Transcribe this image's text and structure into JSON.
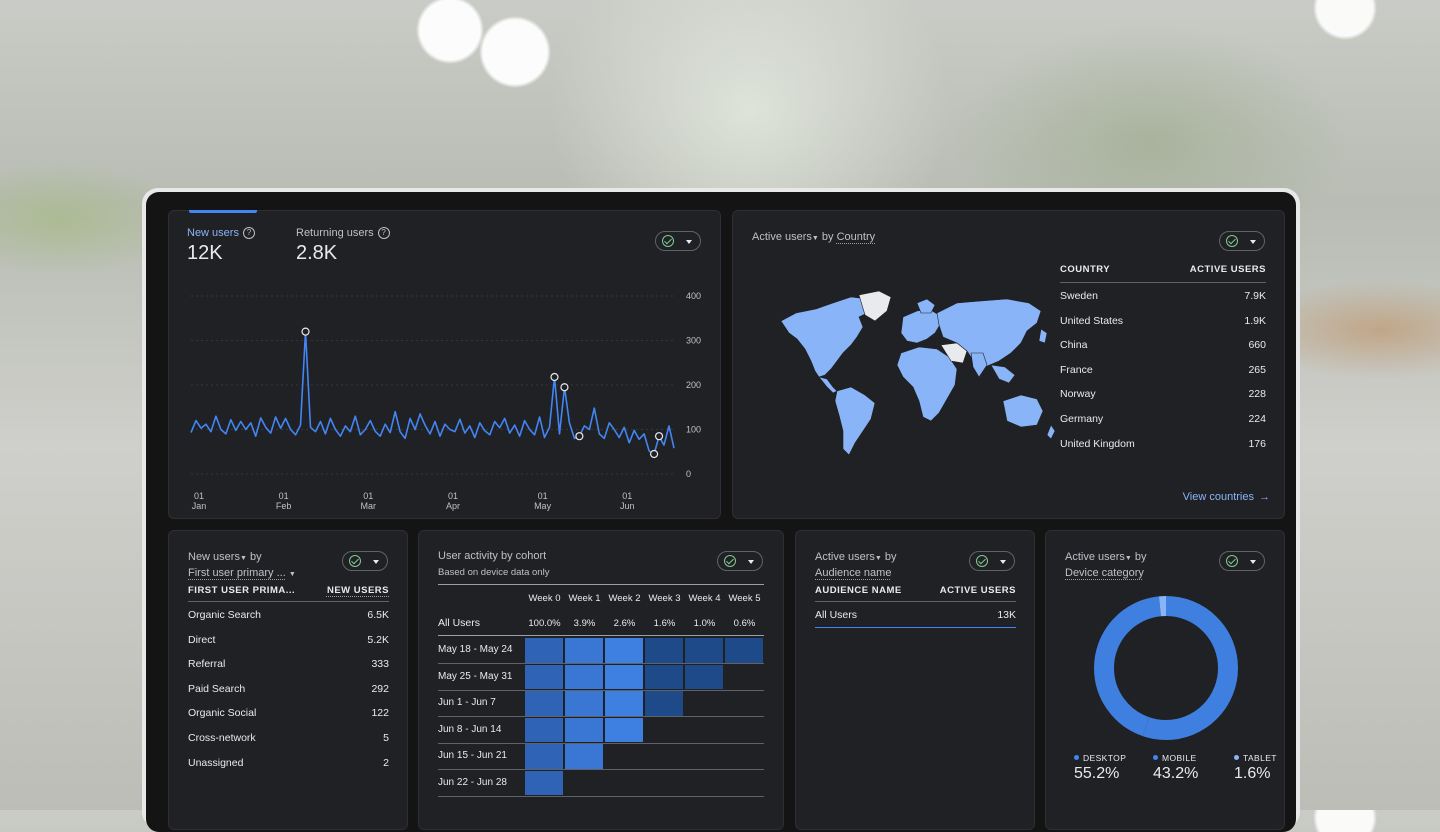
{
  "users_card": {
    "metric1_label": "New users",
    "metric1_value": "12K",
    "metric2_label": "Returning users",
    "metric2_value": "2.8K",
    "help_glyph": "?",
    "y_ticks": [
      "400",
      "300",
      "200",
      "100",
      "0"
    ],
    "x_ticks": [
      {
        "d": "01",
        "m": "Jan"
      },
      {
        "d": "01",
        "m": "Feb"
      },
      {
        "d": "01",
        "m": "Mar"
      },
      {
        "d": "01",
        "m": "Apr"
      },
      {
        "d": "01",
        "m": "May"
      },
      {
        "d": "01",
        "m": "Jun"
      }
    ],
    "line_color": "#4285f4",
    "series": [
      93,
      120,
      103,
      112,
      95,
      130,
      100,
      90,
      122,
      98,
      118,
      100,
      115,
      85,
      126,
      105,
      92,
      128,
      103,
      125,
      100,
      88,
      110,
      320,
      105,
      95,
      118,
      90,
      125,
      100,
      85,
      108,
      95,
      130,
      88,
      100,
      120,
      96,
      85,
      112,
      93,
      140,
      95,
      80,
      125,
      100,
      135,
      110,
      90,
      118,
      85,
      112,
      100,
      95,
      123,
      92,
      108,
      82,
      115,
      97,
      88,
      118,
      104,
      125,
      92,
      110,
      85,
      120,
      100,
      88,
      128,
      82,
      105,
      218,
      90,
      195,
      115,
      80,
      85,
      108,
      100,
      148,
      90,
      80,
      115,
      100,
      82,
      105,
      70,
      98,
      78,
      90,
      52,
      45,
      85,
      65,
      108,
      58
    ]
  },
  "country_card": {
    "title_metric": "Active users",
    "title_by": " by ",
    "title_dim": "Country",
    "col1": "COUNTRY",
    "col2": "ACTIVE USERS",
    "rows": [
      {
        "name": "Sweden",
        "value": "7.9K"
      },
      {
        "name": "United States",
        "value": "1.9K"
      },
      {
        "name": "China",
        "value": "660"
      },
      {
        "name": "France",
        "value": "265"
      },
      {
        "name": "Norway",
        "value": "228"
      },
      {
        "name": "Germany",
        "value": "224"
      },
      {
        "name": "United Kingdom",
        "value": "176"
      }
    ],
    "link": "View countries",
    "map_color": "#8ab4f8"
  },
  "source_card": {
    "title_metric": "New users",
    "title_by": " by",
    "title_dim": "First user primary ...",
    "col1": "FIRST USER PRIMA...",
    "col2": "NEW USERS",
    "rows": [
      {
        "name": "Organic Search",
        "value": "6.5K"
      },
      {
        "name": "Direct",
        "value": "5.2K"
      },
      {
        "name": "Referral",
        "value": "333"
      },
      {
        "name": "Paid Search",
        "value": "292"
      },
      {
        "name": "Organic Social",
        "value": "122"
      },
      {
        "name": "Cross-network",
        "value": "5"
      },
      {
        "name": "Unassigned",
        "value": "2"
      }
    ]
  },
  "cohort_card": {
    "title": "User activity by cohort",
    "subtitle": "Based on device data only",
    "weeks": [
      "Week 0",
      "Week 1",
      "Week 2",
      "Week 3",
      "Week 4",
      "Week 5"
    ],
    "all_label": "All Users",
    "all_values": [
      "100.0%",
      "3.9%",
      "2.6%",
      "1.6%",
      "1.0%",
      "0.6%"
    ],
    "rows": [
      {
        "label": "May 18 - May 24",
        "cells": [
          1,
          0.8,
          0.6,
          0.35,
          0.35,
          0.35
        ]
      },
      {
        "label": "May 25 - May 31",
        "cells": [
          1,
          0.8,
          0.6,
          0.35,
          0.35
        ]
      },
      {
        "label": "Jun 1 - Jun 7",
        "cells": [
          1,
          0.8,
          0.6,
          0.35
        ]
      },
      {
        "label": "Jun 8 - Jun 14",
        "cells": [
          1,
          0.8,
          0.5
        ]
      },
      {
        "label": "Jun 15 - Jun 21",
        "cells": [
          1,
          0.8
        ]
      },
      {
        "label": "Jun 22 - Jun 28",
        "cells": [
          1
        ]
      }
    ]
  },
  "audience_card": {
    "title_metric": "Active users",
    "title_by": " by",
    "title_dim": "Audience name",
    "col1": "AUDIENCE NAME",
    "col2": "ACTIVE USERS",
    "rows": [
      {
        "name": "All Users",
        "value": "13K"
      }
    ]
  },
  "device_card": {
    "title_metric": "Active users",
    "title_by": " by",
    "title_dim": "Device category",
    "legend": [
      {
        "label": "DESKTOP",
        "value": "55.2%",
        "color": "#4285f4"
      },
      {
        "label": "MOBILE",
        "value": "43.2%",
        "color": "#4285f4"
      },
      {
        "label": "TABLET",
        "value": "1.6%",
        "color": "#8ab4f8"
      }
    ],
    "donut_shares": [
      55.2,
      43.2,
      1.6
    ],
    "donut_colors": [
      "#3f7fe0",
      "#3f7fe0",
      "#8ab4f8"
    ]
  }
}
